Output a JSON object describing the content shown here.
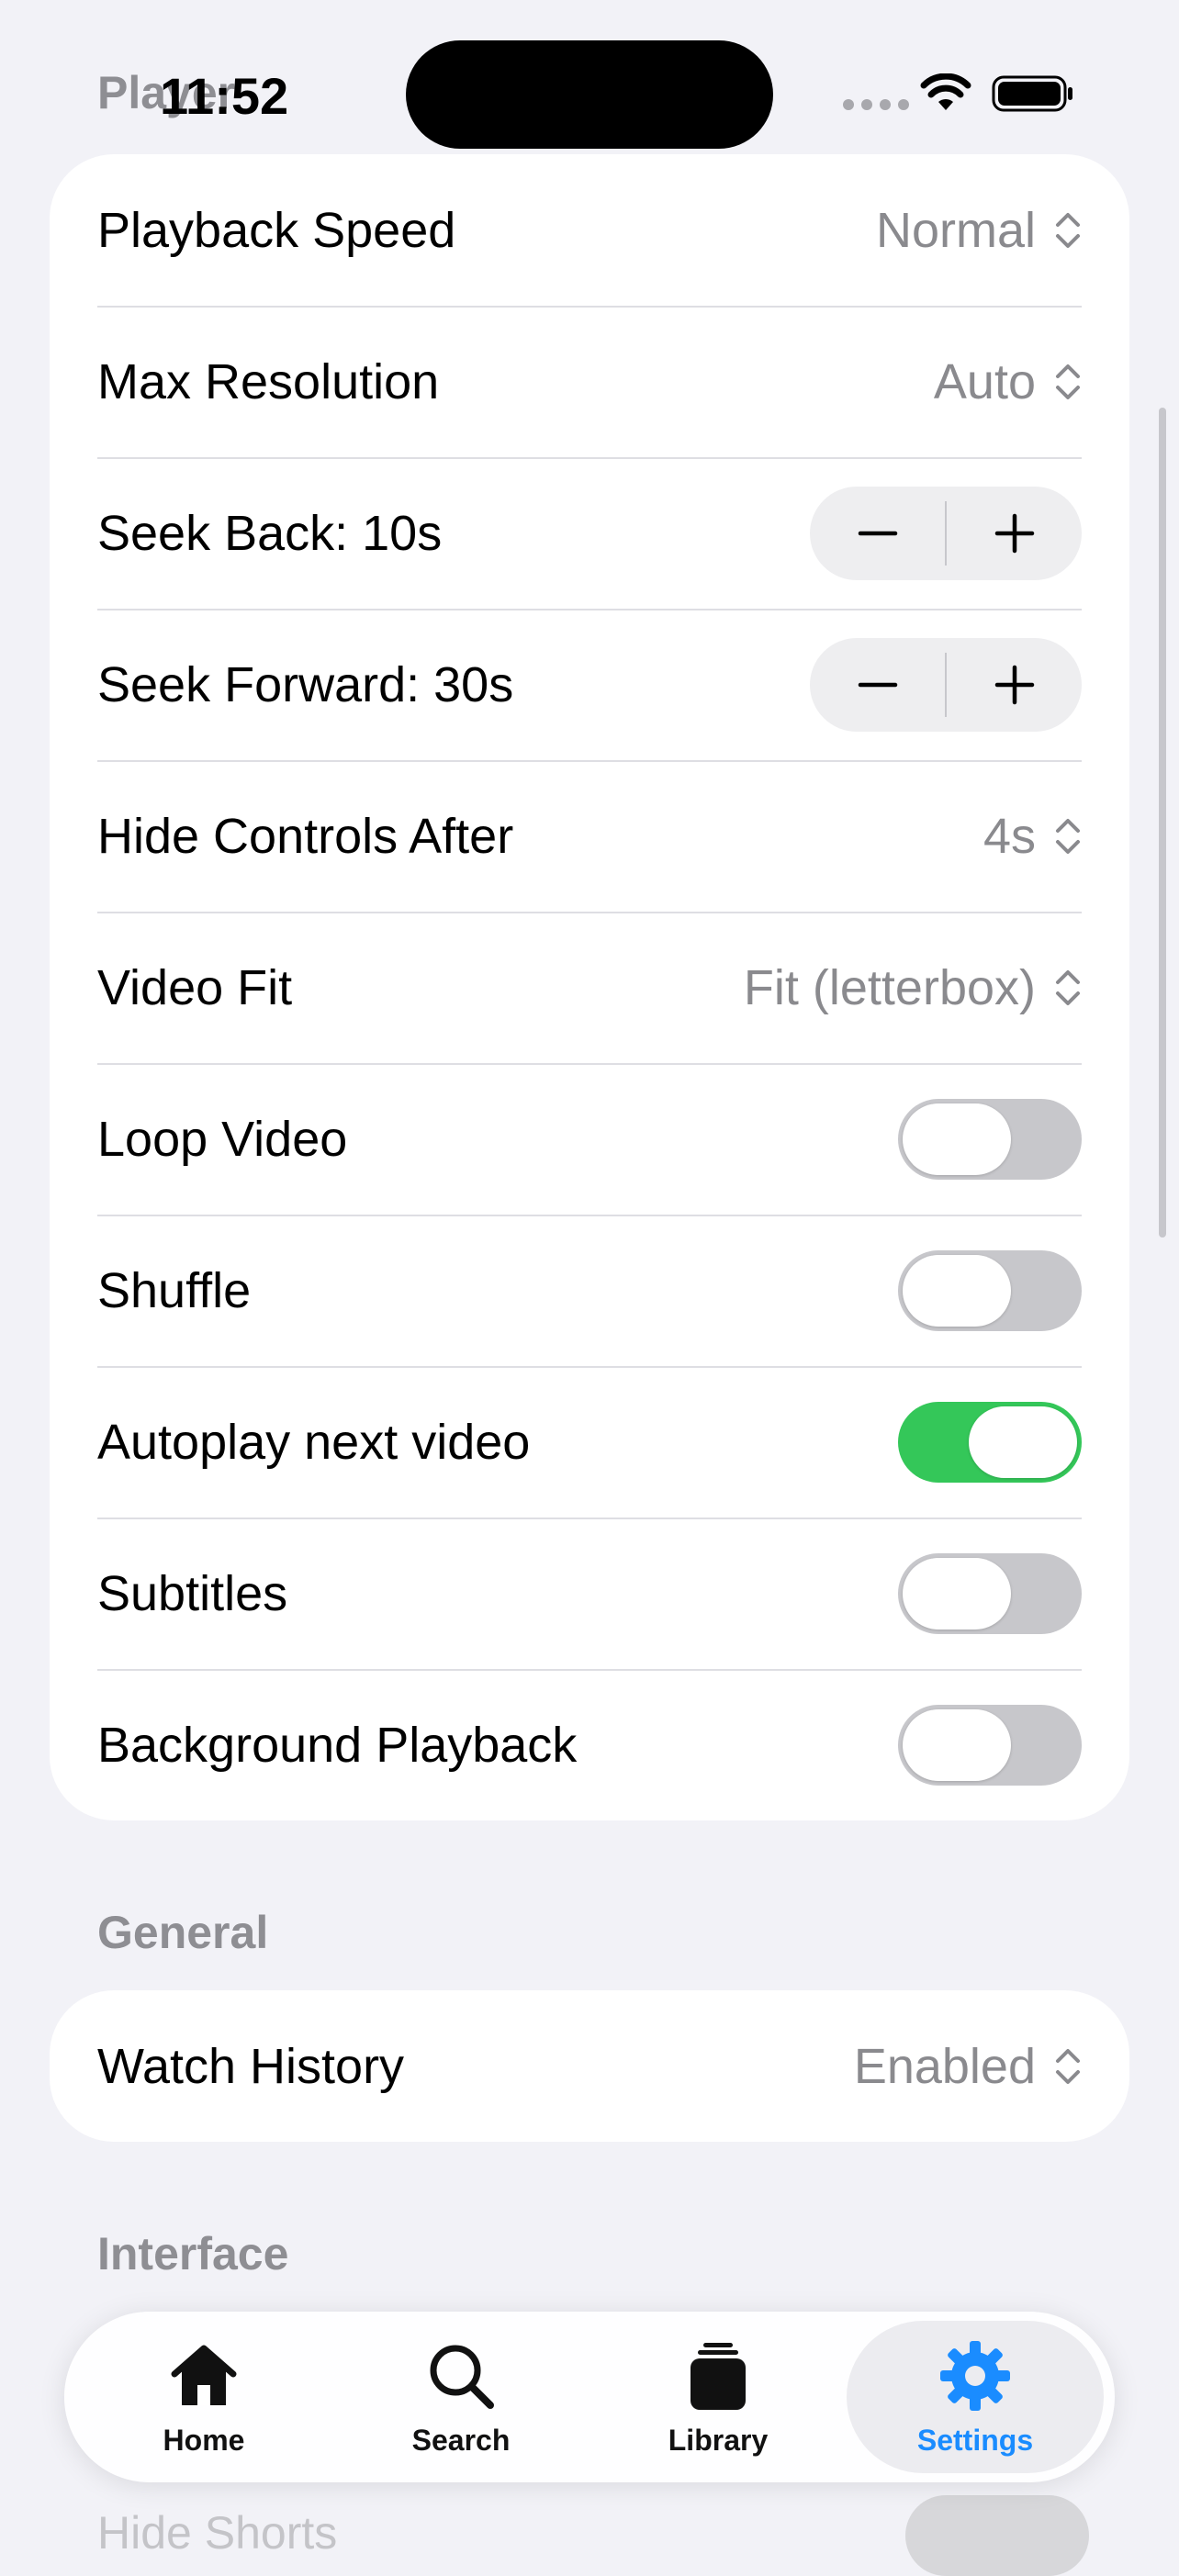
{
  "status_bar": {
    "section_peek": "Player",
    "time": "11:52"
  },
  "player_settings": [
    {
      "label": "Playback Speed",
      "type": "picker",
      "value": "Normal"
    },
    {
      "label": "Max Resolution",
      "type": "picker",
      "value": "Auto"
    },
    {
      "label": "Seek Back: 10s",
      "type": "stepper"
    },
    {
      "label": "Seek Forward: 30s",
      "type": "stepper"
    },
    {
      "label": "Hide Controls After",
      "type": "picker",
      "value": "4s"
    },
    {
      "label": "Video Fit",
      "type": "picker",
      "value": "Fit (letterbox)"
    },
    {
      "label": "Loop Video",
      "type": "toggle",
      "on": false
    },
    {
      "label": "Shuffle",
      "type": "toggle",
      "on": false
    },
    {
      "label": "Autoplay next video",
      "type": "toggle",
      "on": true
    },
    {
      "label": "Subtitles",
      "type": "toggle",
      "on": false
    },
    {
      "label": "Background Playback",
      "type": "toggle",
      "on": false
    }
  ],
  "general": {
    "header": "General",
    "items": [
      {
        "label": "Watch History",
        "type": "picker",
        "value": "Enabled"
      }
    ]
  },
  "interface": {
    "header": "Interface",
    "peek_item": "Hide Shorts"
  },
  "tabbar": {
    "tabs": [
      {
        "label": "Home",
        "icon": "house-icon",
        "active": false
      },
      {
        "label": "Search",
        "icon": "magnifier-icon",
        "active": false
      },
      {
        "label": "Library",
        "icon": "library-stack-icon",
        "active": false
      },
      {
        "label": "Settings",
        "icon": "gear-icon",
        "active": true
      }
    ]
  },
  "colors": {
    "toggle_on": "#34c759",
    "accent": "#1a8cff",
    "background": "#f2f2f7"
  }
}
